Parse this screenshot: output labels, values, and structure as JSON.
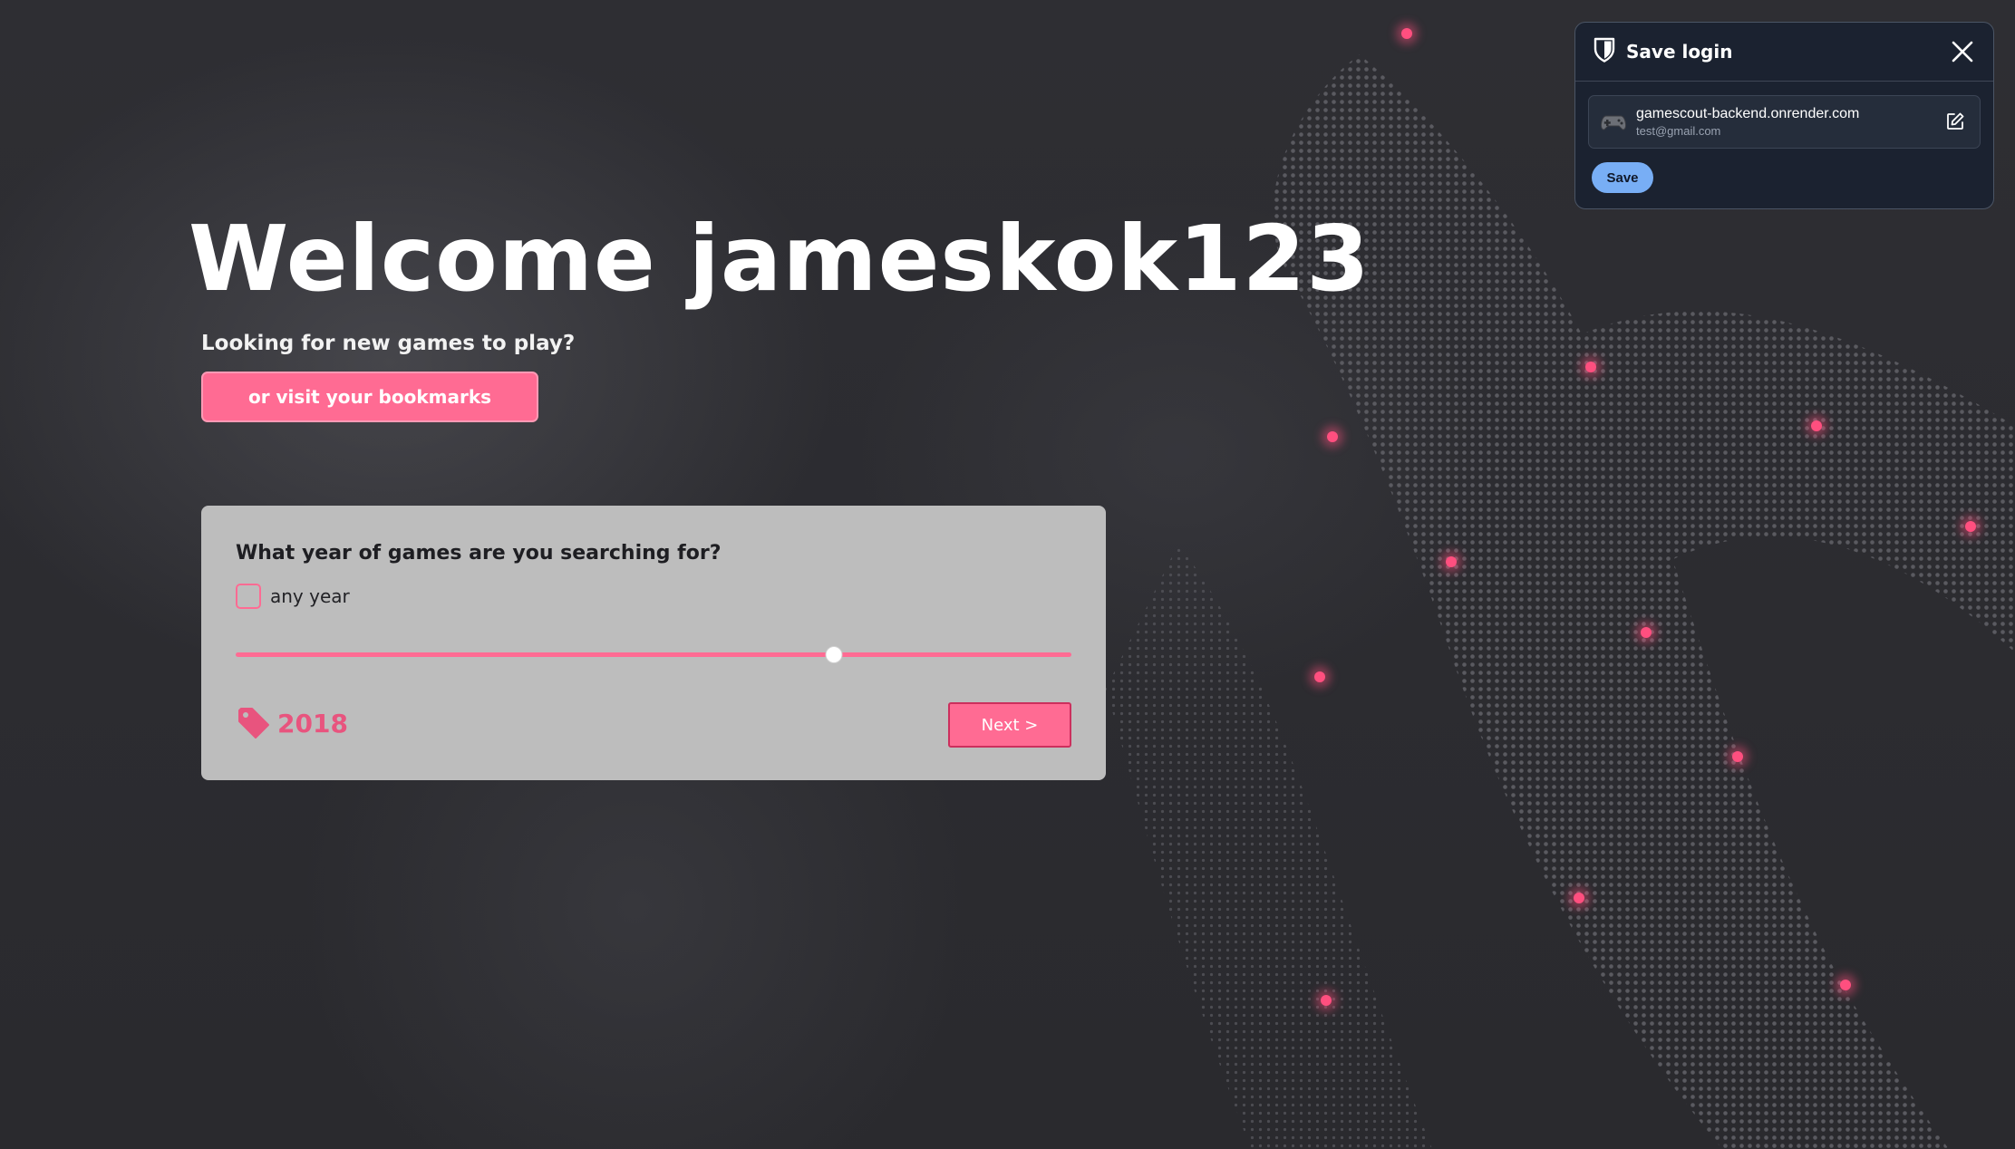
{
  "hero": {
    "title": "Welcome jameskok123",
    "subtitle": "Looking for new games to play?",
    "bookmarks_button": "or visit your bookmarks"
  },
  "year_card": {
    "question": "What year of games are you searching for?",
    "any_year_label": "any year",
    "any_year_checked": false,
    "slider_fraction": 0.716,
    "selected_year": "2018",
    "next_button": "Next >"
  },
  "save_login_popup": {
    "title": "Save login",
    "site": "gamescout-backend.onrender.com",
    "username": "test@gmail.com",
    "save_button": "Save"
  },
  "icons": {
    "shield": "shield-icon",
    "close": "close-icon",
    "gamepad": "gamepad-icon",
    "edit": "edit-icon",
    "tag": "tag-icon"
  },
  "colors": {
    "accent_pink": "#ff6b93",
    "year_pink": "#e8547e",
    "popup_bg": "#1b2230",
    "save_blue": "#78aef5",
    "card_bg": "#bdbdbd"
  }
}
